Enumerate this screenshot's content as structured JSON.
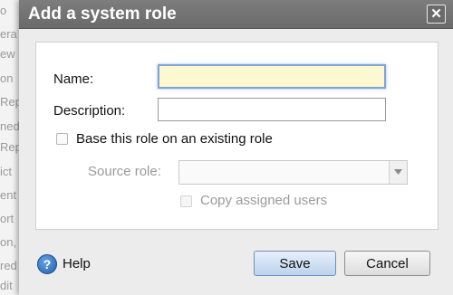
{
  "background": {
    "lines": [
      "o",
      "era",
      "ew",
      "on",
      "Rep",
      "ned",
      "Rep",
      "ict",
      "ent",
      "ort",
      "on,",
      "red",
      "dit"
    ]
  },
  "dialog": {
    "title": "Add a system role",
    "close_label": "x",
    "form": {
      "name_label": "Name:",
      "name_value": "",
      "description_label": "Description:",
      "description_value": "",
      "base_role_checkbox_label": "Base this role on an existing role",
      "base_role_checked": false,
      "source_role_label": "Source role:",
      "source_role_value": "",
      "copy_users_label": "Copy assigned users",
      "copy_users_checked": false
    },
    "footer": {
      "help_label": "Help",
      "save_label": "Save",
      "cancel_label": "Cancel"
    }
  },
  "colors": {
    "titlebar": "#6f6f6f",
    "focused_input_bg": "#fcf9d2",
    "save_button": "#c9dbf2"
  }
}
